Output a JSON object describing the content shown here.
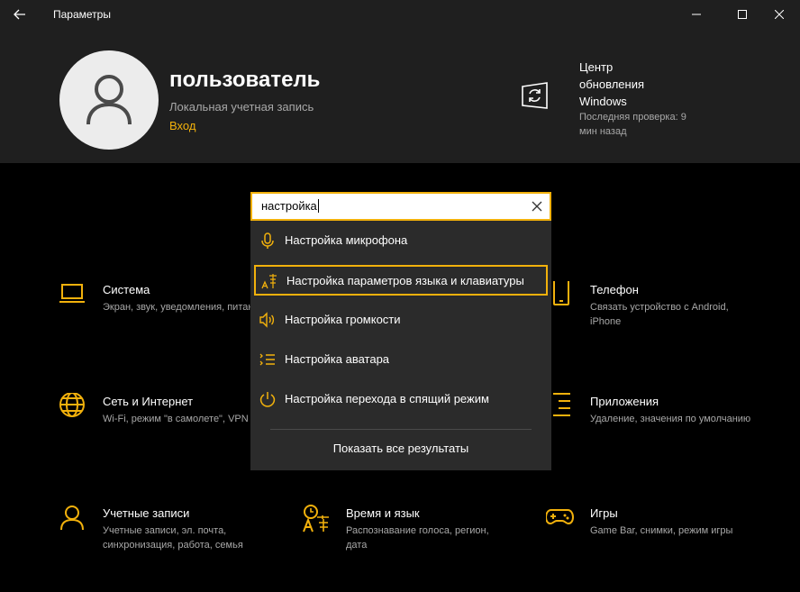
{
  "window": {
    "title": "Параметры"
  },
  "account": {
    "name": "пользователь",
    "type": "Локальная учетная запись",
    "signin_link": "Вход"
  },
  "update": {
    "title": "Центр обновления Windows",
    "subtitle": "Последняя проверка: 9 мин назад"
  },
  "search": {
    "value": "настройка",
    "results": [
      {
        "label": "Настройка микрофона",
        "icon": "microphone-icon"
      },
      {
        "label": "Настройка параметров языка и клавиатуры",
        "icon": "language-icon",
        "selected": true
      },
      {
        "label": "Настройка громкости",
        "icon": "speaker-icon"
      },
      {
        "label": "Настройка аватара",
        "icon": "avatar-list-icon"
      },
      {
        "label": "Настройка перехода в спящий режим",
        "icon": "power-icon"
      }
    ],
    "show_all": "Показать все результаты"
  },
  "categories": {
    "system": {
      "title": "Система",
      "desc": "Экран, звук, уведомления, питание"
    },
    "phone": {
      "title": "Телефон",
      "desc": "Связать устройство с Android, iPhone"
    },
    "network": {
      "title": "Сеть и Интернет",
      "desc": "Wi-Fi, режим \"в самолете\", VPN"
    },
    "apps": {
      "title": "Приложения",
      "desc": "Удаление, значения по умолчанию"
    },
    "accounts": {
      "title": "Учетные записи",
      "desc": "Учетные записи, эл. почта, синхронизация, работа, семья"
    },
    "time": {
      "title": "Время и язык",
      "desc": "Распознавание голоса, регион, дата"
    },
    "gaming": {
      "title": "Игры",
      "desc": "Game Bar, снимки, режим игры"
    }
  },
  "colors": {
    "accent": "#f2b10c",
    "header_bg": "#1f1f1f",
    "body_bg": "#000000",
    "dropdown_bg": "#2b2b2b"
  }
}
